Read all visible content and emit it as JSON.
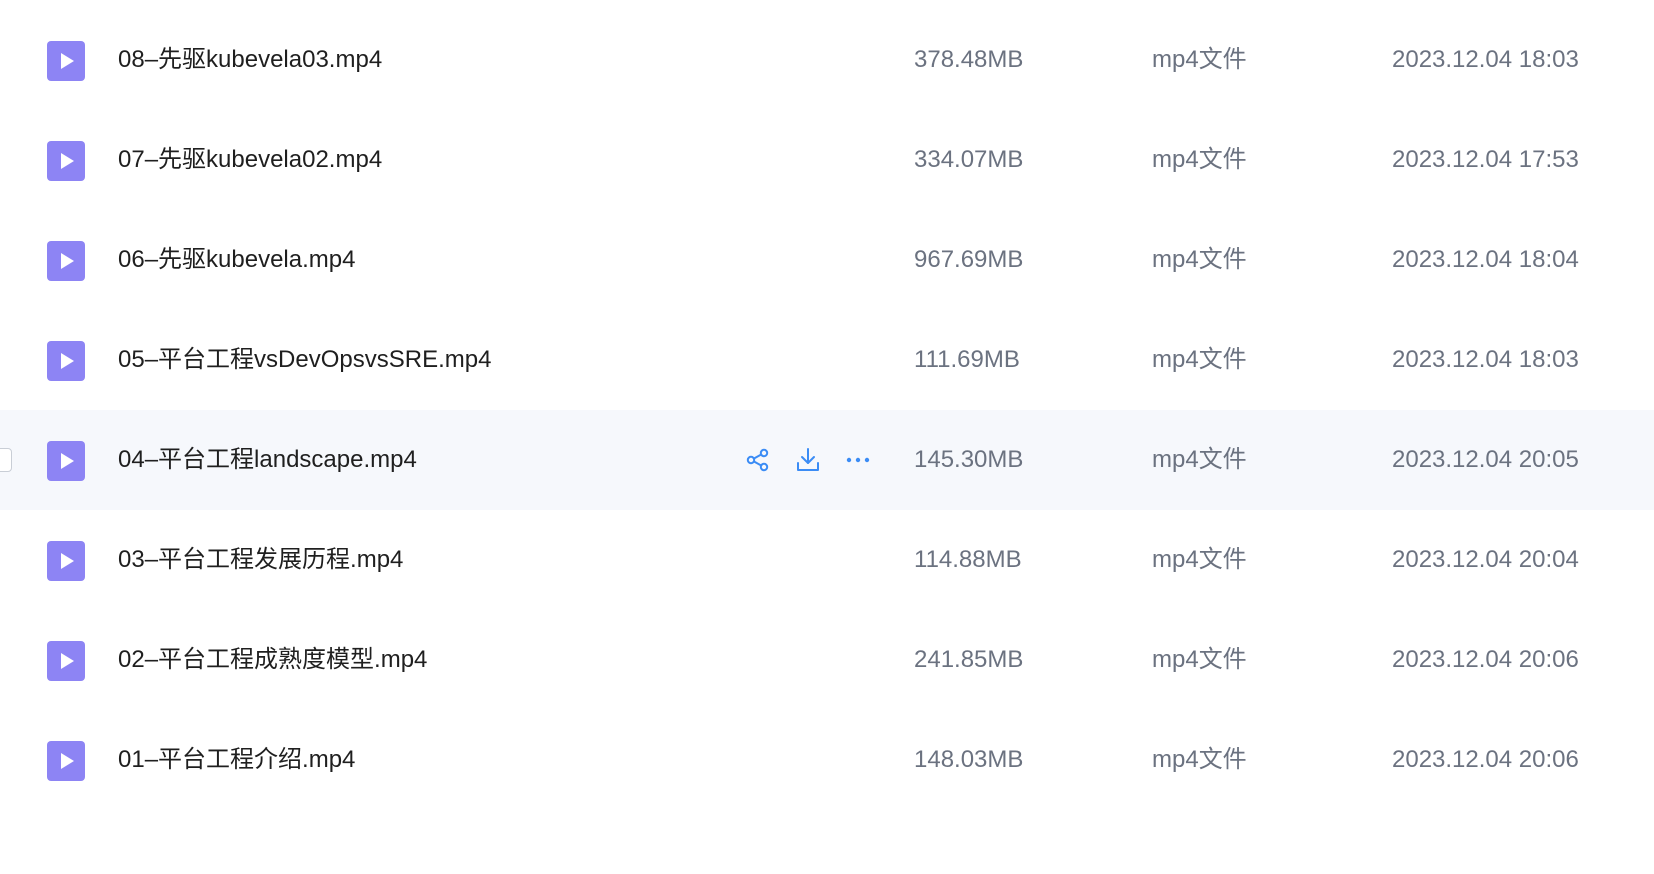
{
  "colors": {
    "icon_fill": "#8d84f4",
    "action_blue": "#3b8cf5",
    "hover_bg": "#f6f8fc",
    "name_text": "#1f1f1f",
    "meta_text": "#6b7280"
  },
  "hover_actions": {
    "share_icon": "share-icon",
    "download_icon": "download-icon",
    "more_icon": "more-icon"
  },
  "files": [
    {
      "name": "08–先驱kubevela03.mp4",
      "size": "378.48MB",
      "type": "mp4文件",
      "date": "2023.12.04 18:03",
      "icon": "video-file-icon"
    },
    {
      "name": "07–先驱kubevela02.mp4",
      "size": "334.07MB",
      "type": "mp4文件",
      "date": "2023.12.04 17:53",
      "icon": "video-file-icon"
    },
    {
      "name": "06–先驱kubevela.mp4",
      "size": "967.69MB",
      "type": "mp4文件",
      "date": "2023.12.04 18:04",
      "icon": "video-file-icon"
    },
    {
      "name": "05–平台工程vsDevOpsvsSRE.mp4",
      "size": "111.69MB",
      "type": "mp4文件",
      "date": "2023.12.04 18:03",
      "icon": "video-file-icon"
    },
    {
      "name": "04–平台工程landscape.mp4",
      "size": "145.30MB",
      "type": "mp4文件",
      "date": "2023.12.04 20:05",
      "icon": "video-file-icon",
      "hovered": true
    },
    {
      "name": "03–平台工程发展历程.mp4",
      "size": "114.88MB",
      "type": "mp4文件",
      "date": "2023.12.04 20:04",
      "icon": "video-file-icon"
    },
    {
      "name": "02–平台工程成熟度模型.mp4",
      "size": "241.85MB",
      "type": "mp4文件",
      "date": "2023.12.04 20:06",
      "icon": "video-file-icon"
    },
    {
      "name": "01–平台工程介绍.mp4",
      "size": "148.03MB",
      "type": "mp4文件",
      "date": "2023.12.04 20:06",
      "icon": "video-file-icon"
    }
  ]
}
